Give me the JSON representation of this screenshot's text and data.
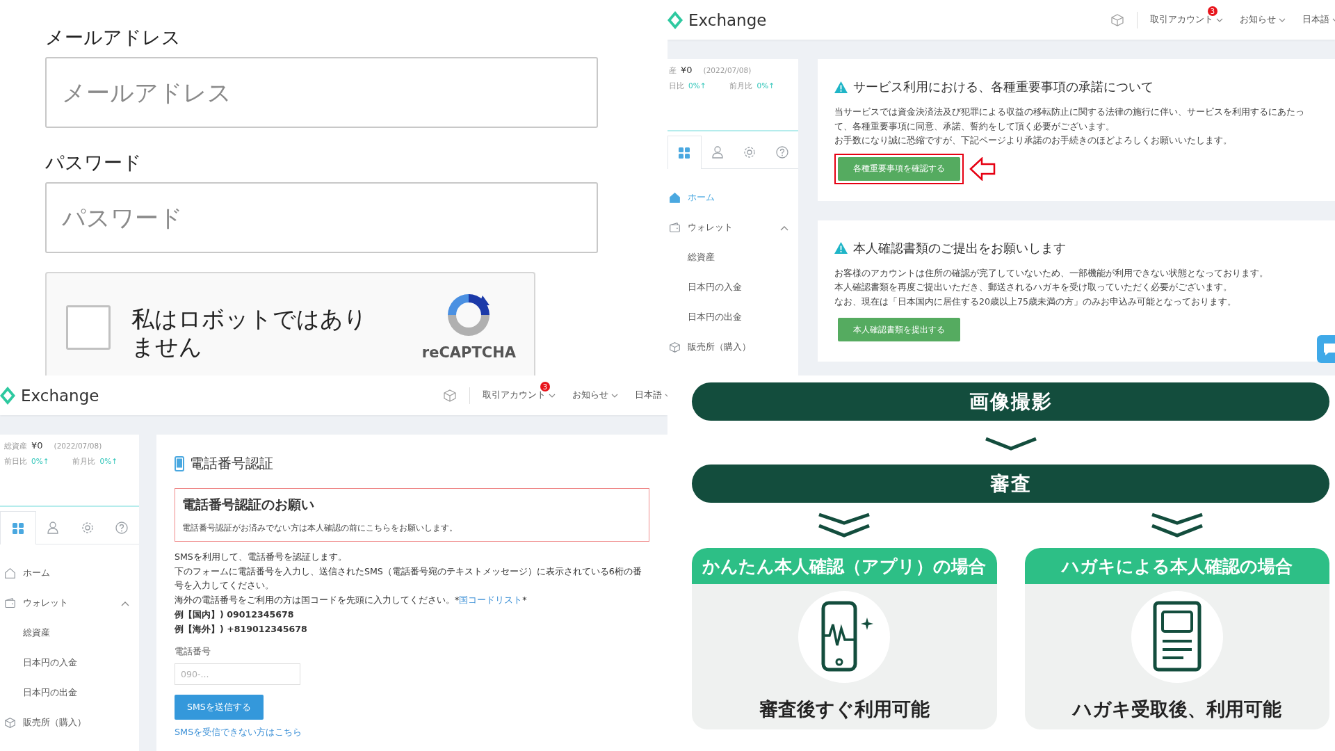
{
  "login_form": {
    "fields": [
      {
        "label": "メールアドレス",
        "placeholder": "メールアドレス"
      },
      {
        "label": "パスワード",
        "placeholder": "パスワード"
      }
    ],
    "captcha": {
      "checked": false,
      "label": "私はロボットではありません",
      "brand": "reCAPTCHA"
    }
  },
  "notice_screen": {
    "header": {
      "logo": "Exchange",
      "menus": [
        {
          "label": "取引アカウント",
          "badge": "3"
        },
        {
          "label": "お知らせ"
        },
        {
          "label": "日本語"
        }
      ]
    },
    "sidebar": {
      "summary": {
        "total_label": "産",
        "total_value": "¥0",
        "date": "(2022/07/08)",
        "day_label": "日比",
        "day_value": "0%↑",
        "month_label": "前月比",
        "month_value": "0%↑"
      },
      "tabs": [
        {
          "kind": "grid",
          "selected": true
        },
        {
          "kind": "person",
          "selected": false
        },
        {
          "kind": "gear",
          "selected": false
        },
        {
          "kind": "help",
          "selected": false
        }
      ],
      "nav": [
        {
          "kind": "home",
          "label": "ホーム",
          "selected": true
        },
        {
          "kind": "wallet",
          "label": "ウォレット",
          "selected": false,
          "expanded": true,
          "children": [
            {
              "label": "総資産"
            },
            {
              "label": "日本円の入金"
            },
            {
              "label": "日本円の出金"
            }
          ]
        },
        {
          "kind": "box",
          "label": "販売所（購入）",
          "selected": false
        }
      ]
    },
    "notices": [
      {
        "title": "サービス利用における、各種重要事項の承諾について",
        "lines": [
          "当サービスでは資金決済法及び犯罪による収益の移転防止に関する法律の施行に伴い、サービスを利用するにあたって、各種重要事項に同意、承諾、誓約をして頂く必要がございます。",
          "お手数になり誠に恐縮ですが、下記ページより承諾のお手続きのほどよろしくお願いいたします。"
        ],
        "button": "各種重要事項を確認する",
        "highlighted": true
      },
      {
        "title": "本人確認書類のご提出をお願いします",
        "lines": [
          "お客様のアカウントは住所の確認が完了していないため、一部機能が利用できない状態となっております。",
          "本人確認書類を再度ご提出いただき、郵送されるハガキを受け取っていただく必要がございます。",
          "なお、現在は「日本国内に居住する20歳以上75歳未満の方」のみお申込み可能となっております。"
        ],
        "button": "本人確認書類を提出する",
        "highlighted": false
      }
    ]
  },
  "phone_screen": {
    "header": {
      "logo": "Exchange",
      "menus": [
        {
          "label": "取引アカウント",
          "badge": "3"
        },
        {
          "label": "お知らせ"
        },
        {
          "label": "日本語"
        }
      ]
    },
    "sidebar": {
      "summary": {
        "total_label": "総資産",
        "total_value": "¥0",
        "date": "(2022/07/08)",
        "day_label": "前日比",
        "day_value": "0%↑",
        "month_label": "前月比",
        "month_value": "0%↑"
      },
      "tabs": [
        {
          "kind": "grid",
          "selected": true
        },
        {
          "kind": "person",
          "selected": false
        },
        {
          "kind": "gear",
          "selected": false
        },
        {
          "kind": "help",
          "selected": false
        }
      ],
      "nav": [
        {
          "kind": "home",
          "label": "ホーム",
          "selected": false
        },
        {
          "kind": "wallet",
          "label": "ウォレット",
          "selected": false,
          "expanded": true,
          "children": [
            {
              "label": "総資産"
            },
            {
              "label": "日本円の入金"
            },
            {
              "label": "日本円の出金"
            }
          ]
        },
        {
          "kind": "box",
          "label": "販売所（購入）",
          "selected": false
        }
      ]
    },
    "title": "電話番号認証",
    "alert": {
      "title": "電話番号認証のお願い",
      "text": "電話番号認証がお済みでない方は本人確認の前にこちらをお願いします。"
    },
    "intro": [
      "SMSを利用して、電話番号を認証します。",
      "下のフォームに電話番号を入力し、送信されたSMS（電話番号宛のテキストメッセージ）に表示されている6桁の番号を入力してください。"
    ],
    "country_note": {
      "text": "海外の電話番号をご利用の方は国コードを先頭に入力してください。*",
      "link": "国コードリスト",
      "suffix": "*"
    },
    "examples": [
      "例【国内】) 09012345678",
      "例【海外】) +819012345678"
    ],
    "field": {
      "label": "電話番号",
      "placeholder": "090-..."
    },
    "button": "SMSを送信する",
    "help_link": "SMSを受信できない方はこちら"
  },
  "flow_diagram": {
    "steps": [
      {
        "label": "画像撮影"
      },
      {
        "label": "審査"
      }
    ],
    "branches": [
      {
        "kind": "app",
        "title": "かんたん本人確認（アプリ）の場合",
        "result": "審査後すぐ利用可能"
      },
      {
        "kind": "postcard",
        "title": "ハガキによる本人確認の場合",
        "result": "ハガキ受取後、利用可能"
      }
    ]
  }
}
